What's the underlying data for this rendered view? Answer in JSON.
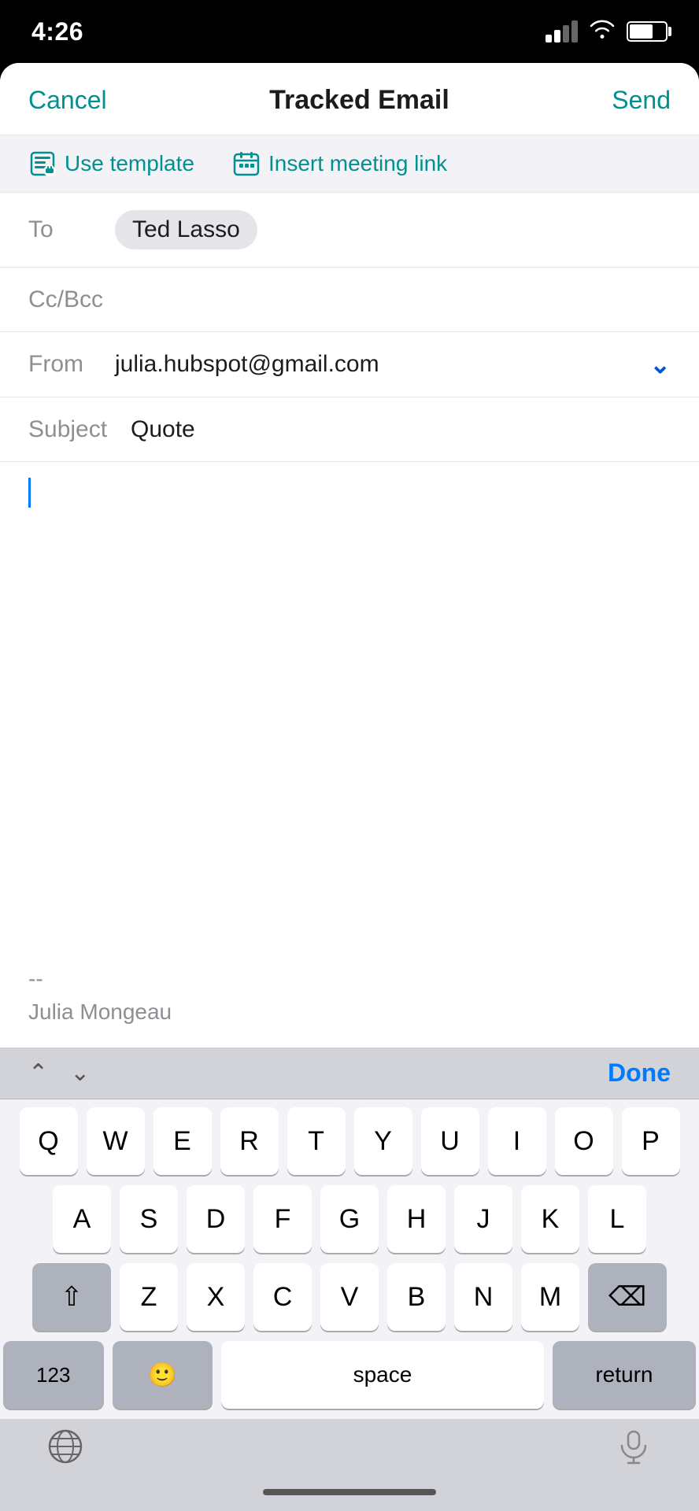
{
  "statusBar": {
    "time": "4:26"
  },
  "header": {
    "cancel": "Cancel",
    "title": "Tracked Email",
    "send": "Send"
  },
  "toolbar": {
    "useTemplate": "Use template",
    "insertMeetingLink": "Insert meeting link"
  },
  "toField": {
    "label": "To",
    "recipient": "Ted Lasso"
  },
  "ccField": {
    "label": "Cc/Bcc"
  },
  "fromField": {
    "label": "From",
    "email": "julia.hubspot@gmail.com"
  },
  "subjectField": {
    "label": "Subject",
    "value": "Quote"
  },
  "emailBody": {
    "signatureSeparator": "--",
    "signatureName": "Julia Mongeau"
  },
  "keyboardToolbar": {
    "done": "Done"
  },
  "keyboard": {
    "row1": [
      "Q",
      "W",
      "E",
      "R",
      "T",
      "Y",
      "U",
      "I",
      "O",
      "P"
    ],
    "row2": [
      "A",
      "S",
      "D",
      "F",
      "G",
      "H",
      "J",
      "K",
      "L"
    ],
    "row3": [
      "Z",
      "X",
      "C",
      "V",
      "B",
      "N",
      "M"
    ],
    "space": "space",
    "return": "return",
    "numbers": "123"
  }
}
